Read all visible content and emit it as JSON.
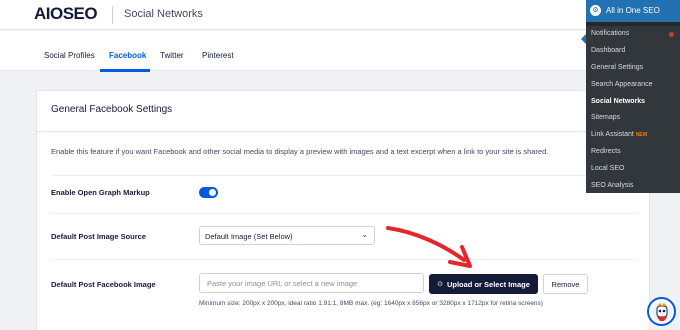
{
  "header": {
    "logo": "AIOSEO",
    "page_title": "Social Networks"
  },
  "tabs": [
    {
      "label": "Social Profiles",
      "active": false
    },
    {
      "label": "Facebook",
      "active": true
    },
    {
      "label": "Twitter",
      "active": false
    },
    {
      "label": "Pinterest",
      "active": false
    }
  ],
  "card": {
    "title": "General Facebook Settings",
    "description": "Enable this feature if you want Facebook and other social media to display a preview with images and a text excerpt when a link to your site is shared.",
    "open_graph": {
      "label": "Enable Open Graph Markup",
      "enabled": true
    },
    "image_source": {
      "label": "Default Post Image Source",
      "selected": "Default Image (Set Below)"
    },
    "post_image": {
      "label": "Default Post Facebook Image",
      "placeholder": "Paste your image URL or select a new image",
      "upload_label": "Upload or Select Image",
      "remove_label": "Remove",
      "hint": "Minimum size: 200px x 200px, ideal ratio 1.91:1, 8MB max. (eg: 1640px x 856px or 3280px x 1712px for retina screens)"
    }
  },
  "admin_menu": {
    "title": "All in One SEO",
    "items": [
      {
        "label": "Notifications",
        "current": false,
        "dot": true
      },
      {
        "label": "Dashboard",
        "current": false
      },
      {
        "label": "General Settings",
        "current": false
      },
      {
        "label": "Search Appearance",
        "current": false
      },
      {
        "label": "Social Networks",
        "current": true
      },
      {
        "label": "Sitemaps",
        "current": false
      },
      {
        "label": "Link Assistant",
        "current": false,
        "badge": "NEW"
      },
      {
        "label": "Redirects",
        "current": false
      },
      {
        "label": "Local SEO",
        "current": false
      },
      {
        "label": "SEO Analysis",
        "current": false
      }
    ]
  },
  "colors": {
    "accent": "#005ae0",
    "dark": "#141b38",
    "admin_bg": "#32373c",
    "admin_highlight": "#2271b1",
    "annotation_arrow": "#e3262b"
  }
}
